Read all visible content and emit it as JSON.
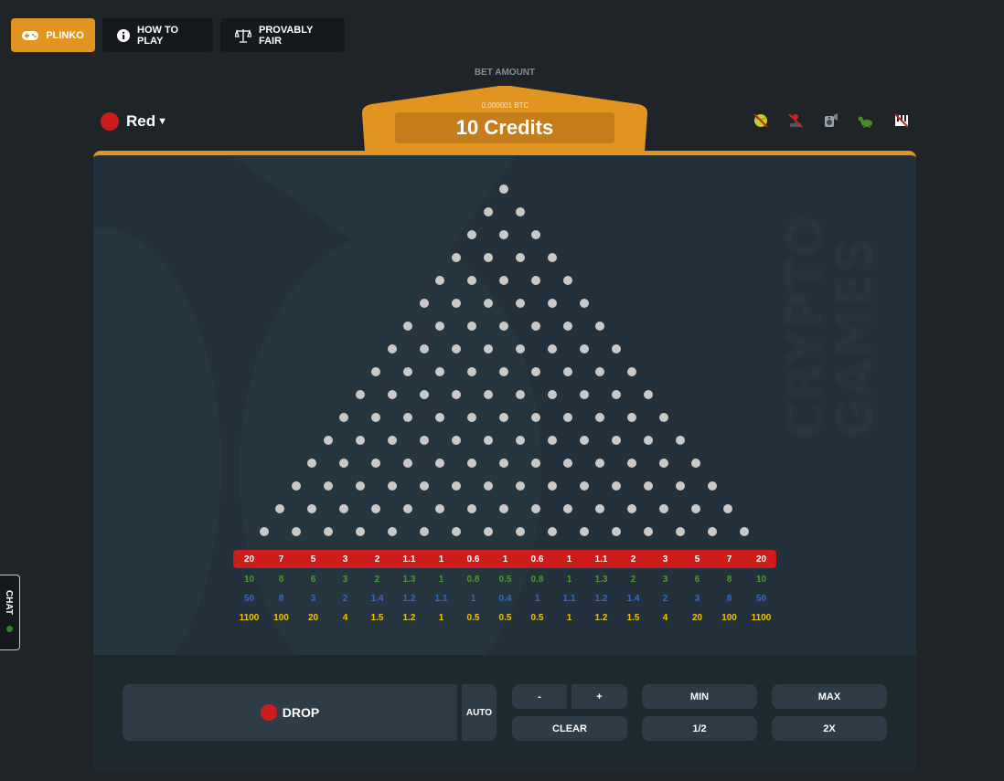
{
  "nav": {
    "items": [
      {
        "label": "PLINKO",
        "icon": "gamepad-icon",
        "active": true
      },
      {
        "label": "HOW TO PLAY",
        "icon": "info-icon",
        "active": false
      },
      {
        "label": "PROVABLY FAIR",
        "icon": "scales-icon",
        "active": false
      }
    ]
  },
  "bet": {
    "label": "BET AMOUNT",
    "btc": "0,000001 BTC",
    "value": "10 Credits"
  },
  "risk": {
    "selected": "Red",
    "color": "#cc1c1c"
  },
  "toggles": [
    {
      "name": "ball-sound-toggle-icon",
      "state": "disabled"
    },
    {
      "name": "joystick-toggle-icon",
      "state": "disabled"
    },
    {
      "name": "speaker-toggle-icon",
      "state": "enabled"
    },
    {
      "name": "turtle-speed-icon",
      "state": "enabled"
    },
    {
      "name": "piano-music-toggle-icon",
      "state": "disabled"
    }
  ],
  "board": {
    "rows": 16,
    "watermark": [
      "CRYPTO",
      "GAMES"
    ]
  },
  "multipliers": {
    "red": [
      "20",
      "7",
      "5",
      "3",
      "2",
      "1.1",
      "1",
      "0.6",
      "1",
      "0.6",
      "1",
      "1.1",
      "2",
      "3",
      "5",
      "7",
      "20"
    ],
    "green": [
      "10",
      "8",
      "6",
      "3",
      "2",
      "1.3",
      "1",
      "0.8",
      "0.5",
      "0.8",
      "1",
      "1.3",
      "2",
      "3",
      "6",
      "8",
      "10"
    ],
    "blue": [
      "50",
      "8",
      "3",
      "2",
      "1.4",
      "1.2",
      "1.1",
      "1",
      "0.4",
      "1",
      "1.1",
      "1.2",
      "1.4",
      "2",
      "3",
      "8",
      "50"
    ],
    "yellow": [
      "1100",
      "100",
      "20",
      "4",
      "1.5",
      "1.2",
      "1",
      "0.5",
      "0.5",
      "0.5",
      "1",
      "1.2",
      "1.5",
      "4",
      "20",
      "100",
      "1100"
    ]
  },
  "controls": {
    "drop": "DROP",
    "auto": "AUTO",
    "minus": "-",
    "plus": "+",
    "clear": "CLEAR",
    "min": "MIN",
    "half": "1/2",
    "max": "MAX",
    "double": "2X"
  },
  "chat": {
    "label": "CHAT",
    "online": true
  }
}
